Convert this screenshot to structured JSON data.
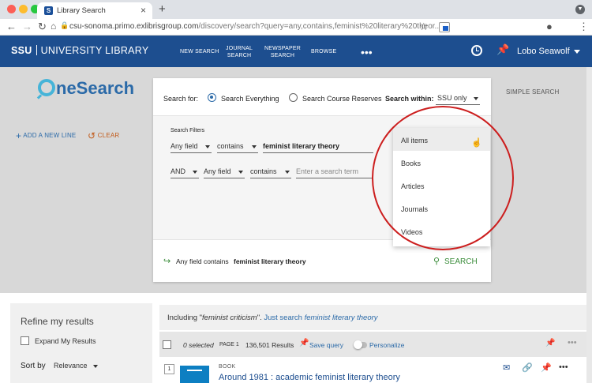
{
  "browser": {
    "tab_title": "Library Search",
    "tab_favicon": "S",
    "url_main": "csu-sonoma.primo.exlibrisgroup.com",
    "url_rest": "/discovery/search?query=any,contains,feminist%20literary%20theor..."
  },
  "header": {
    "logo_main": "SSU",
    "logo_sub": "UNIVERSITY LIBRARY",
    "nav": [
      "NEW SEARCH",
      "JOURNAL SEARCH",
      "NEWSPAPER SEARCH",
      "BROWSE"
    ],
    "nav_lines": [
      [
        "NEW SEARCH"
      ],
      [
        "JOURNAL",
        "SEARCH"
      ],
      [
        "NEWSPAPER",
        "SEARCH"
      ],
      [
        "BROWSE"
      ]
    ],
    "more": "•••",
    "user": "Lobo Seawolf"
  },
  "search": {
    "logo_text": "neSearch",
    "simple_search": "SIMPLE SEARCH",
    "search_for_label": "Search for:",
    "radio_everything": "Search Everything",
    "radio_reserves": "Search Course Reserves",
    "search_within_label": "Search within:",
    "search_within_value": "SSU only",
    "filters_label": "Search Filters",
    "row1": {
      "field": "Any field",
      "op": "contains",
      "term": "feminist literary theory"
    },
    "row2": {
      "bool": "AND",
      "field": "Any field",
      "op": "contains",
      "placeholder": "Enter a search term"
    },
    "add_line": "ADD A NEW LINE",
    "clear": "CLEAR",
    "summary_field": "Any field",
    "summary_op": "contains",
    "summary_term": "feminist literary theory",
    "search_button": "SEARCH"
  },
  "dropdown": {
    "options": [
      "All items",
      "Books",
      "Articles",
      "Journals",
      "Videos"
    ],
    "highlighted": "All items"
  },
  "results": {
    "refine_title": "Refine my results",
    "expand_label": "Expand My Results",
    "sort_label": "Sort by",
    "sort_value": "Relevance",
    "including_prefix": "Including \"",
    "including_term": "feminist criticism",
    "including_mid": "\". ",
    "just_search_prefix": "Just search ",
    "just_search_term": "feminist literary theory",
    "selected": "0 selected",
    "page": "PAGE 1",
    "count": "136,501 Results",
    "save_query": "Save query",
    "personalize": "Personalize",
    "item_number": "1",
    "item_type": "BOOK",
    "item_title": "Around 1981 : academic feminist literary theory"
  },
  "colors": {
    "brand_blue": "#1d4e8f",
    "accent_blue": "#2b6aa8",
    "highlight_circle": "#cc1e1e",
    "search_green": "#3a8c3a"
  }
}
